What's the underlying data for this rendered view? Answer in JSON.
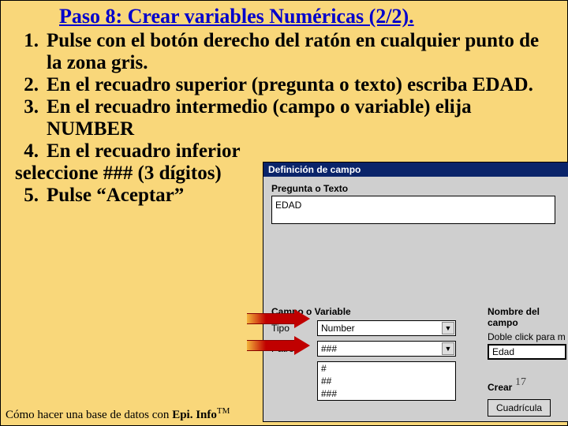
{
  "title": "Paso 8: Crear variables Numéricas (2/2).",
  "steps": {
    "n1": "1.",
    "t1": "Pulse con el botón derecho del ratón en cualquier punto de la zona gris.",
    "n2": "2.",
    "t2": "En el recuadro superior (pregunta o texto) escriba EDAD.",
    "n3": "3.",
    "t3": "En el recuadro intermedio (campo o variable) elija NUMBER",
    "n4": "4.",
    "t4a": "En el recuadro inferior",
    "t4b": "seleccione ### (3 dígitos)",
    "n5": "5.",
    "t5": "Pulse  “Aceptar”"
  },
  "dialog": {
    "title": "Definición de campo",
    "question_label": "Pregunta o Texto",
    "question_value": "EDAD",
    "field_section": "Campo o Variable",
    "type_label": "Tipo",
    "type_value": "Number",
    "pattern_label": "Patrón",
    "pattern_value": "###",
    "pattern_options": [
      "#",
      "##",
      "###"
    ],
    "right_name_label": "Nombre del campo",
    "right_name_hint": "Doble click para m",
    "right_name_value": "Edad",
    "right_create_label": "Crear",
    "right_grid_btn": "Cuadrícula"
  },
  "footer": {
    "prefix": "Cómo hacer una base de datos con ",
    "brand": "Epi. Info",
    "tm": "TM"
  },
  "page": "17"
}
